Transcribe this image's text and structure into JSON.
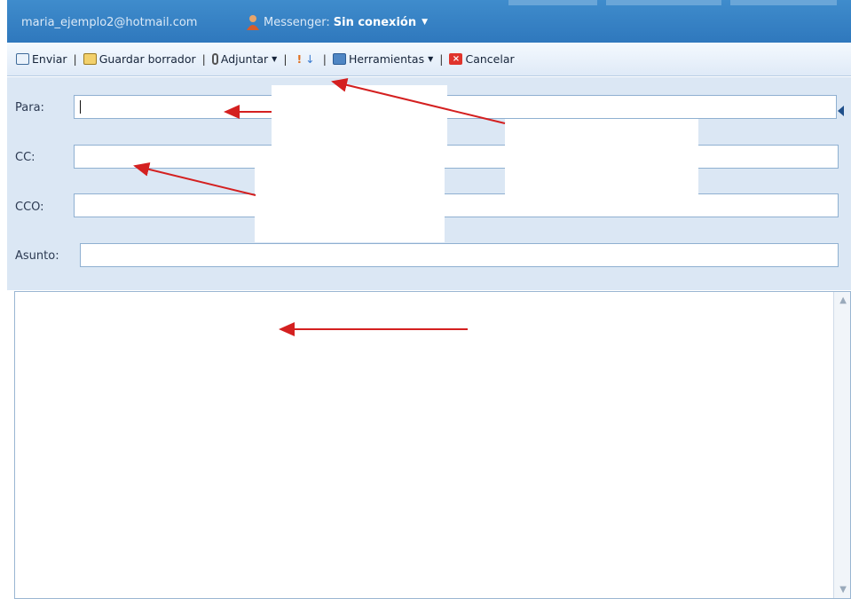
{
  "header": {
    "account_email": "maria_ejemplo2@hotmail.com",
    "messenger_label": "Messenger:",
    "messenger_status": "Sin conexión"
  },
  "toolbar": {
    "send_label": "Enviar",
    "save_draft_label": "Guardar borrador",
    "attach_label": "Adjuntar",
    "tools_label": "Herramientas",
    "cancel_label": "Cancelar"
  },
  "fields": {
    "to_label": "Para:",
    "cc_label": "CC:",
    "bcc_label": "CCO:",
    "subject_label": "Asunto:",
    "to_value": "",
    "cc_value": "",
    "bcc_value": "",
    "subject_value": ""
  },
  "icons": {
    "send": "send-icon",
    "draft": "save-draft-icon",
    "attach": "paperclip-icon",
    "priority_high": "priority-high-icon",
    "priority_low": "priority-low-icon",
    "tools": "tools-icon",
    "cancel": "cancel-icon",
    "messenger": "messenger-user-icon"
  },
  "colors": {
    "header_blue": "#2f78bd",
    "toolbar_bg": "#e4eef9",
    "form_bg": "#dbe7f4",
    "annotation_arrow": "#d42020"
  }
}
